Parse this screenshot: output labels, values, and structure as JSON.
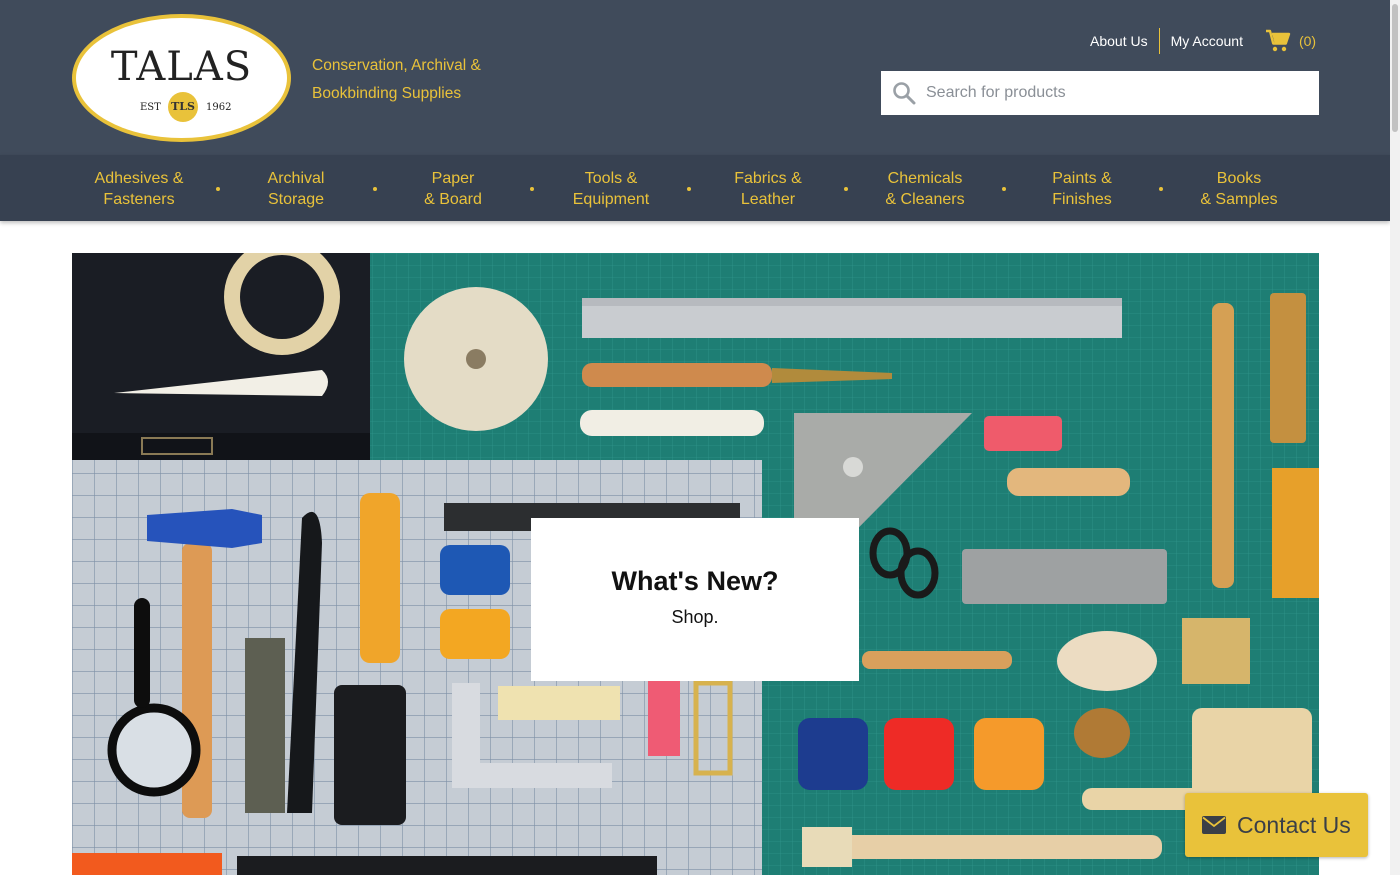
{
  "brand": {
    "name": "TALAS",
    "est": "EST",
    "monogram": "TLS",
    "year": "1962",
    "tagline_line1": "Conservation, Archival &",
    "tagline_line2": "Bookbinding Supplies",
    "gold": "#e9c23a",
    "header_bg": "#404b5b",
    "nav_bg": "#374151"
  },
  "header": {
    "about_label": "About Us",
    "account_label": "My Account",
    "cart_icon": "shopping-cart-icon",
    "cart_count": "(0)"
  },
  "search": {
    "icon": "search-icon",
    "placeholder": "Search for products",
    "value": ""
  },
  "nav": {
    "items": [
      {
        "label": "Adhesives &\nFasteners"
      },
      {
        "label": "Archival\nStorage"
      },
      {
        "label": "Paper\n& Board"
      },
      {
        "label": "Tools &\nEquipment"
      },
      {
        "label": "Fabrics &\nLeather"
      },
      {
        "label": "Chemicals\n& Cleaners"
      },
      {
        "label": "Paints &\nFinishes"
      },
      {
        "label": "Books\n& Samples"
      }
    ]
  },
  "hero": {
    "image": "flat-lay of conservation and bookbinding tools",
    "promo_title": "What's New?",
    "promo_subtitle": "Shop."
  },
  "contact": {
    "icon": "envelope-icon",
    "label": "Contact Us"
  }
}
